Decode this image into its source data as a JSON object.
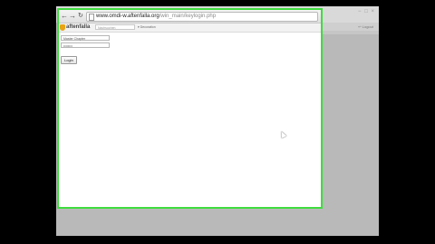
{
  "browser": {
    "url_host": "www.omdi-w.aftenfalla.org",
    "url_path": "/win_main/keylogin.php",
    "window_controls": "− □ ×"
  },
  "site": {
    "logo": "aftenfalla",
    "search_placeholder": "Nachsuchen",
    "nav_dropdown": "▾ Decoration",
    "right_link": "↩ Logout"
  },
  "login": {
    "username_placeholder": "Master Chapter",
    "password_value": "••••••••",
    "login_label": "Login"
  },
  "colors": {
    "window_border": "#3fdc3f",
    "logo_accent": "#e8a317"
  }
}
